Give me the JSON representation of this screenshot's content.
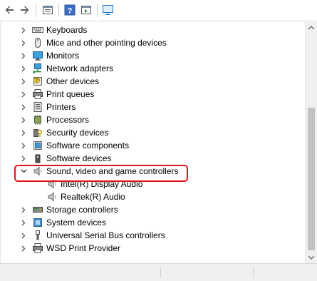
{
  "toolbar": {
    "icons": [
      "back-arrow-icon",
      "forward-arrow-icon",
      "properties-icon",
      "help-icon",
      "action-pane-icon",
      "monitor-scan-icon"
    ]
  },
  "tree": {
    "items": [
      {
        "label": "Keyboards",
        "icon": "keyboard-icon",
        "expanded": false
      },
      {
        "label": "Mice and other pointing devices",
        "icon": "mouse-icon",
        "expanded": false
      },
      {
        "label": "Monitors",
        "icon": "monitor-icon",
        "expanded": false
      },
      {
        "label": "Network adapters",
        "icon": "network-adapter-icon",
        "expanded": false
      },
      {
        "label": "Other devices",
        "icon": "other-device-icon",
        "expanded": false
      },
      {
        "label": "Print queues",
        "icon": "print-queue-icon",
        "expanded": false
      },
      {
        "label": "Printers",
        "icon": "printer-icon",
        "expanded": false
      },
      {
        "label": "Processors",
        "icon": "processor-icon",
        "expanded": false
      },
      {
        "label": "Security devices",
        "icon": "security-device-icon",
        "expanded": false
      },
      {
        "label": "Software components",
        "icon": "software-component-icon",
        "expanded": false
      },
      {
        "label": "Software devices",
        "icon": "software-device-icon",
        "expanded": false
      },
      {
        "label": "Sound, video and game controllers",
        "icon": "speaker-icon",
        "expanded": true
      },
      {
        "label": "Intel(R) Display Audio",
        "icon": "speaker-icon",
        "child": true
      },
      {
        "label": "Realtek(R) Audio",
        "icon": "speaker-icon",
        "child": true
      },
      {
        "label": "Storage controllers",
        "icon": "storage-controller-icon",
        "expanded": false
      },
      {
        "label": "System devices",
        "icon": "system-device-icon",
        "expanded": false
      },
      {
        "label": "Universal Serial Bus controllers",
        "icon": "usb-icon",
        "expanded": false
      },
      {
        "label": "WSD Print Provider",
        "icon": "wsd-printer-icon",
        "expanded": false
      }
    ]
  },
  "colors": {
    "highlight_border": "#e3131b",
    "accent_blue": "#1e73be"
  }
}
